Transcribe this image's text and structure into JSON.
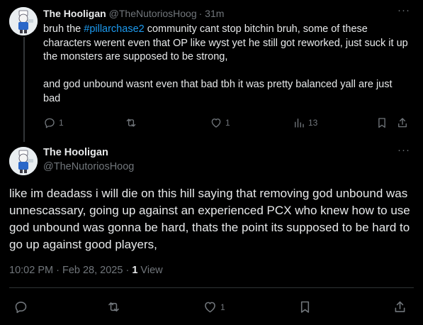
{
  "tweet1": {
    "name": "The Hooligan",
    "handle": "@TheNutoriosHoog",
    "time": "· 31m",
    "body_pre": "bruh the ",
    "hashtag": "#pillarchase2",
    "body_post": " community cant stop bitchin bruh, some of these characters werent even that OP like wyst yet he still got reworked, just suck it up the monsters are supposed to be strong,",
    "body_p2": "and god unbound wasnt even that bad tbh it was pretty balanced yall are just bad",
    "replies": "1",
    "likes": "1",
    "views": "13"
  },
  "tweet2": {
    "name": "The Hooligan",
    "handle": "@TheNutoriosHoog",
    "body": "like im deadass i will die on this hill saying that removing god unbound was unnescassary, going up against an experienced PCX who knew how to use god unbound was gonna be hard, thats the point its supposed to be hard to go up against good players,",
    "time": "10:02 PM",
    "sep1": " · ",
    "date": "Feb 28, 2025",
    "sep2": " · ",
    "views": "1",
    "views_label": " View",
    "likes": "1"
  },
  "colors": {
    "background": "#000000",
    "text": "#e7e9ea",
    "muted": "#71767b",
    "link": "#1d9bf0",
    "divider": "#2f3336"
  },
  "icons": [
    "reply-icon",
    "retweet-icon",
    "like-icon",
    "views-icon",
    "bookmark-icon",
    "share-icon",
    "more-icon"
  ]
}
